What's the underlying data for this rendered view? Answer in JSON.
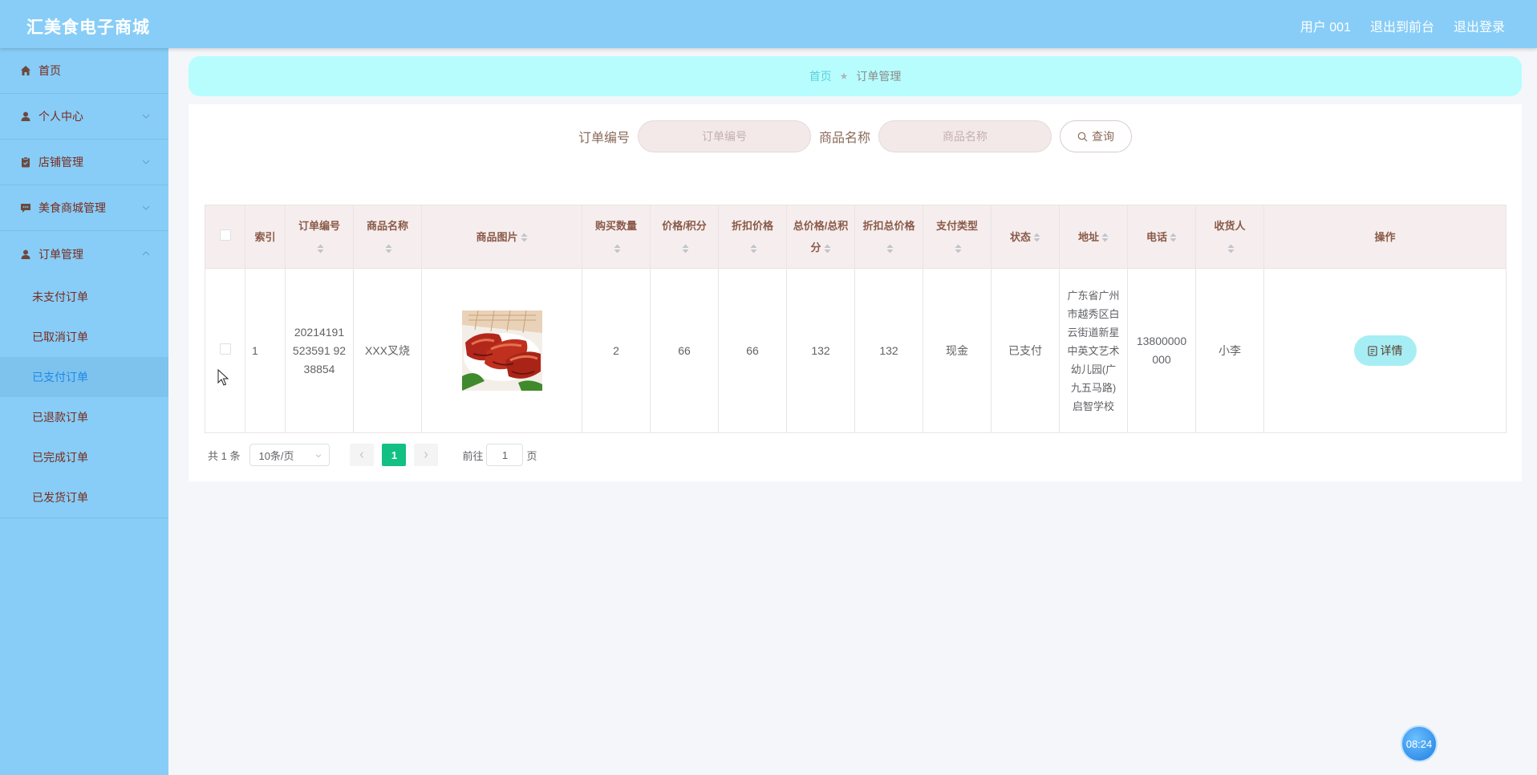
{
  "app": {
    "title": "汇美食电子商城"
  },
  "topnav": {
    "user": "用户 001",
    "frontend": "退出到前台",
    "logout": "退出登录"
  },
  "sidebar": {
    "items": [
      {
        "label": "首页",
        "icon": "home-icon"
      },
      {
        "label": "个人中心",
        "icon": "user-icon"
      },
      {
        "label": "店铺管理",
        "icon": "clipboard-icon"
      },
      {
        "label": "美食商城管理",
        "icon": "chat-icon"
      },
      {
        "label": "订单管理",
        "icon": "user-icon"
      }
    ],
    "order_sub": [
      "未支付订单",
      "已取消订单",
      "已支付订单",
      "已退款订单",
      "已完成订单",
      "已发货订单"
    ]
  },
  "breadcrumb": {
    "home": "首页",
    "current": "订单管理"
  },
  "search": {
    "order_no_label": "订单编号",
    "order_no_placeholder": "订单编号",
    "product_label": "商品名称",
    "product_placeholder": "商品名称",
    "button": "查询"
  },
  "table": {
    "headers": {
      "index": "索引",
      "order_no": "订单编号",
      "product": "商品名称",
      "image": "商品图片",
      "qty": "购买数量",
      "price": "价格/积分",
      "discount": "折扣价格",
      "total": "总价格/总积分",
      "discount_total": "折扣总价格",
      "pay_type": "支付类型",
      "status": "状态",
      "address": "地址",
      "phone": "电话",
      "receiver": "收货人",
      "action": "操作"
    },
    "row": {
      "index": "1",
      "order_no": "20214191523591 9238854",
      "product": "XXX叉烧",
      "qty": "2",
      "price": "66",
      "discount": "66",
      "total": "132",
      "discount_total": "132",
      "pay_type": "现金",
      "status": "已支付",
      "address": "广东省广州市越秀区白云街道新星中英文艺术幼儿园(广九五马路)启智学校",
      "phone": "13800000000",
      "receiver": "小李",
      "detail_btn": "详情"
    }
  },
  "pagination": {
    "total": "共 1 条",
    "page_size": "10条/页",
    "current": "1",
    "goto_prefix": "前往",
    "goto_value": "1",
    "goto_suffix": "页"
  },
  "clock": "08:24",
  "colors": {
    "header": "#87cdf7",
    "accent": "#13c084",
    "breadcrumb_bg": "#b8fdfd",
    "detail_btn": "#a6eef4"
  }
}
